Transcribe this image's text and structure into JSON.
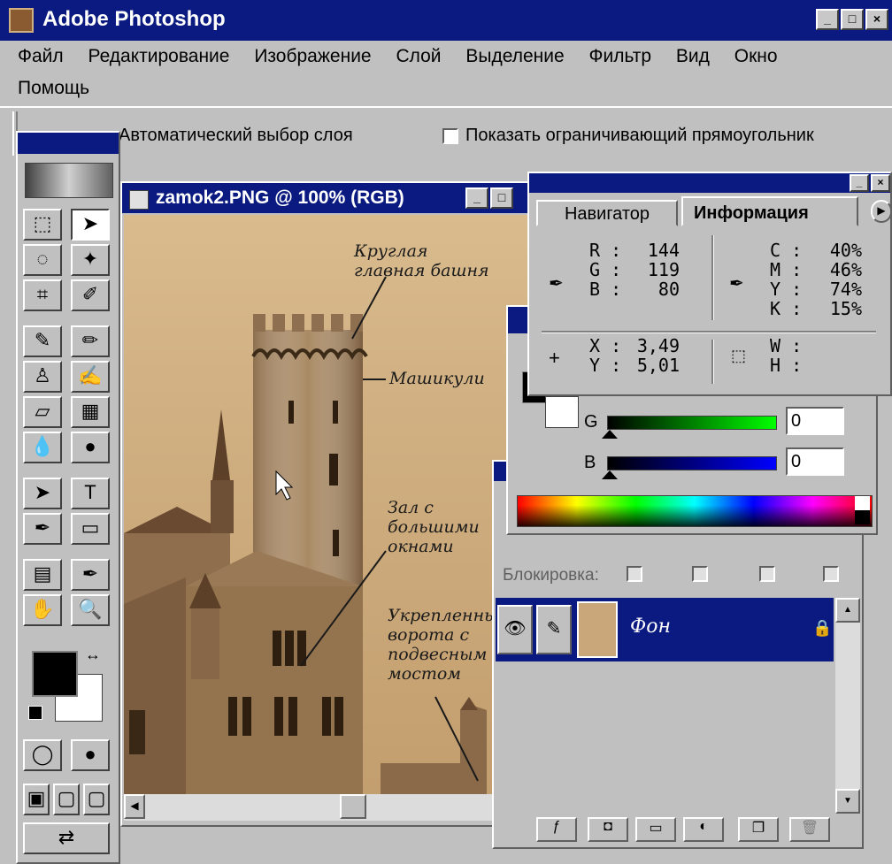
{
  "app": {
    "title": "Adobe Photoshop"
  },
  "menu": {
    "items": [
      "Файл",
      "Редактирование",
      "Изображение",
      "Слой",
      "Выделение",
      "Фильтр",
      "Вид",
      "Окно"
    ],
    "second_row": [
      "Помощь"
    ]
  },
  "options": {
    "auto_select": "Автоматический выбор слоя",
    "show_bounds": "Показать ограничивающий прямоугольник"
  },
  "document": {
    "title": "zamok2.PNG @ 100% (RGB)",
    "labels": {
      "tower": "Круглая главная башня",
      "machicolations": "Машикули",
      "hall": "Зал с большими окнами",
      "gate": "Укрепленные ворота с подвесным мостом"
    }
  },
  "info_panel": {
    "tabs": [
      "Навигатор",
      "Информация"
    ],
    "active_tab": "Информация",
    "rgb": {
      "labels": [
        "R :",
        "G :",
        "B :"
      ],
      "values": [
        "144",
        "119",
        "80"
      ]
    },
    "cmyk": {
      "labels": [
        "C :",
        "M :",
        "Y :",
        "K :"
      ],
      "values": [
        "40%",
        "46%",
        "74%",
        "15%"
      ]
    },
    "xy": {
      "labels": [
        "X :",
        "Y :"
      ],
      "values": [
        "3,49",
        "5,01"
      ]
    },
    "wh": {
      "labels": [
        "W :",
        "H :"
      ]
    }
  },
  "color_panel": {
    "g_label": "G",
    "g_value": "0",
    "b_label": "B",
    "b_value": "0"
  },
  "layers_panel": {
    "lock_label": "Блокировка:",
    "layer_name": "Фон"
  },
  "colors": {
    "title_bar": "#0a1a80",
    "panel": "#c0c0c0",
    "sepia": "#c9a77a"
  }
}
